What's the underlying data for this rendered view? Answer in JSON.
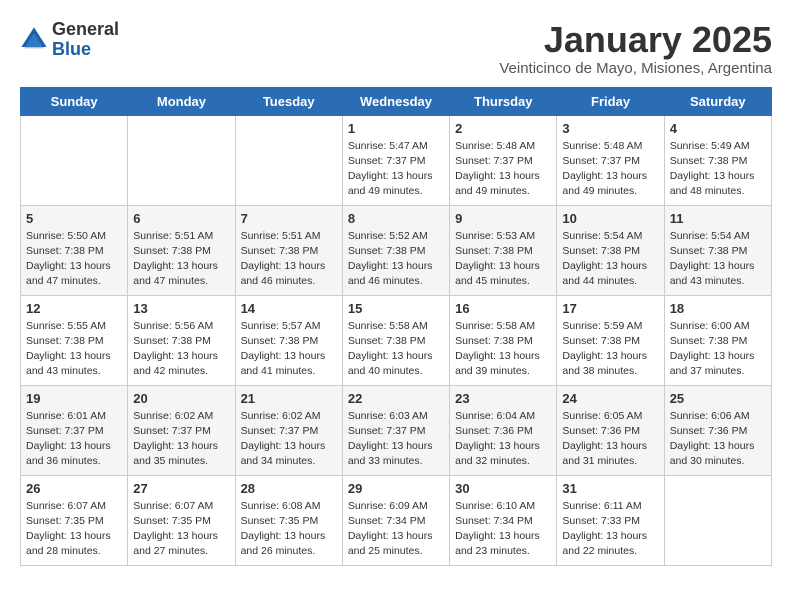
{
  "header": {
    "logo_general": "General",
    "logo_blue": "Blue",
    "month_title": "January 2025",
    "subtitle": "Veinticinco de Mayo, Misiones, Argentina"
  },
  "weekdays": [
    "Sunday",
    "Monday",
    "Tuesday",
    "Wednesday",
    "Thursday",
    "Friday",
    "Saturday"
  ],
  "weeks": [
    [
      {
        "day": "",
        "info": ""
      },
      {
        "day": "",
        "info": ""
      },
      {
        "day": "",
        "info": ""
      },
      {
        "day": "1",
        "info": "Sunrise: 5:47 AM\nSunset: 7:37 PM\nDaylight: 13 hours\nand 49 minutes."
      },
      {
        "day": "2",
        "info": "Sunrise: 5:48 AM\nSunset: 7:37 PM\nDaylight: 13 hours\nand 49 minutes."
      },
      {
        "day": "3",
        "info": "Sunrise: 5:48 AM\nSunset: 7:37 PM\nDaylight: 13 hours\nand 49 minutes."
      },
      {
        "day": "4",
        "info": "Sunrise: 5:49 AM\nSunset: 7:38 PM\nDaylight: 13 hours\nand 48 minutes."
      }
    ],
    [
      {
        "day": "5",
        "info": "Sunrise: 5:50 AM\nSunset: 7:38 PM\nDaylight: 13 hours\nand 47 minutes."
      },
      {
        "day": "6",
        "info": "Sunrise: 5:51 AM\nSunset: 7:38 PM\nDaylight: 13 hours\nand 47 minutes."
      },
      {
        "day": "7",
        "info": "Sunrise: 5:51 AM\nSunset: 7:38 PM\nDaylight: 13 hours\nand 46 minutes."
      },
      {
        "day": "8",
        "info": "Sunrise: 5:52 AM\nSunset: 7:38 PM\nDaylight: 13 hours\nand 46 minutes."
      },
      {
        "day": "9",
        "info": "Sunrise: 5:53 AM\nSunset: 7:38 PM\nDaylight: 13 hours\nand 45 minutes."
      },
      {
        "day": "10",
        "info": "Sunrise: 5:54 AM\nSunset: 7:38 PM\nDaylight: 13 hours\nand 44 minutes."
      },
      {
        "day": "11",
        "info": "Sunrise: 5:54 AM\nSunset: 7:38 PM\nDaylight: 13 hours\nand 43 minutes."
      }
    ],
    [
      {
        "day": "12",
        "info": "Sunrise: 5:55 AM\nSunset: 7:38 PM\nDaylight: 13 hours\nand 43 minutes."
      },
      {
        "day": "13",
        "info": "Sunrise: 5:56 AM\nSunset: 7:38 PM\nDaylight: 13 hours\nand 42 minutes."
      },
      {
        "day": "14",
        "info": "Sunrise: 5:57 AM\nSunset: 7:38 PM\nDaylight: 13 hours\nand 41 minutes."
      },
      {
        "day": "15",
        "info": "Sunrise: 5:58 AM\nSunset: 7:38 PM\nDaylight: 13 hours\nand 40 minutes."
      },
      {
        "day": "16",
        "info": "Sunrise: 5:58 AM\nSunset: 7:38 PM\nDaylight: 13 hours\nand 39 minutes."
      },
      {
        "day": "17",
        "info": "Sunrise: 5:59 AM\nSunset: 7:38 PM\nDaylight: 13 hours\nand 38 minutes."
      },
      {
        "day": "18",
        "info": "Sunrise: 6:00 AM\nSunset: 7:38 PM\nDaylight: 13 hours\nand 37 minutes."
      }
    ],
    [
      {
        "day": "19",
        "info": "Sunrise: 6:01 AM\nSunset: 7:37 PM\nDaylight: 13 hours\nand 36 minutes."
      },
      {
        "day": "20",
        "info": "Sunrise: 6:02 AM\nSunset: 7:37 PM\nDaylight: 13 hours\nand 35 minutes."
      },
      {
        "day": "21",
        "info": "Sunrise: 6:02 AM\nSunset: 7:37 PM\nDaylight: 13 hours\nand 34 minutes."
      },
      {
        "day": "22",
        "info": "Sunrise: 6:03 AM\nSunset: 7:37 PM\nDaylight: 13 hours\nand 33 minutes."
      },
      {
        "day": "23",
        "info": "Sunrise: 6:04 AM\nSunset: 7:36 PM\nDaylight: 13 hours\nand 32 minutes."
      },
      {
        "day": "24",
        "info": "Sunrise: 6:05 AM\nSunset: 7:36 PM\nDaylight: 13 hours\nand 31 minutes."
      },
      {
        "day": "25",
        "info": "Sunrise: 6:06 AM\nSunset: 7:36 PM\nDaylight: 13 hours\nand 30 minutes."
      }
    ],
    [
      {
        "day": "26",
        "info": "Sunrise: 6:07 AM\nSunset: 7:35 PM\nDaylight: 13 hours\nand 28 minutes."
      },
      {
        "day": "27",
        "info": "Sunrise: 6:07 AM\nSunset: 7:35 PM\nDaylight: 13 hours\nand 27 minutes."
      },
      {
        "day": "28",
        "info": "Sunrise: 6:08 AM\nSunset: 7:35 PM\nDaylight: 13 hours\nand 26 minutes."
      },
      {
        "day": "29",
        "info": "Sunrise: 6:09 AM\nSunset: 7:34 PM\nDaylight: 13 hours\nand 25 minutes."
      },
      {
        "day": "30",
        "info": "Sunrise: 6:10 AM\nSunset: 7:34 PM\nDaylight: 13 hours\nand 23 minutes."
      },
      {
        "day": "31",
        "info": "Sunrise: 6:11 AM\nSunset: 7:33 PM\nDaylight: 13 hours\nand 22 minutes."
      },
      {
        "day": "",
        "info": ""
      }
    ]
  ]
}
